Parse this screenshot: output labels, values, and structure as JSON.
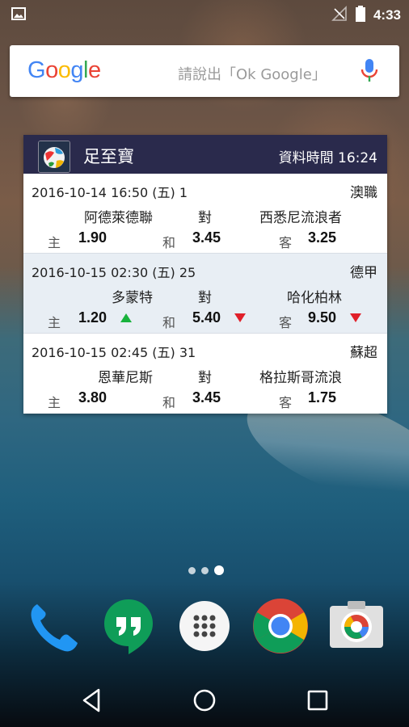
{
  "status_bar": {
    "time": "4:33",
    "icons": [
      "image-notification-icon",
      "no-signal-icon",
      "battery-icon"
    ]
  },
  "search_bar": {
    "logo": "Google",
    "hint": "請說出「Ok Google」",
    "mic_icon": "mic-icon"
  },
  "widget": {
    "app_name": "足至寶",
    "update_time": "資料時間 16:24",
    "matches": [
      {
        "datetime": "2016-10-14 16:50 (五) 1",
        "league": "澳職",
        "home_team": "阿德萊德聯",
        "vs": "對",
        "away_team": "西悉尼流浪者",
        "home_label": "主",
        "home_odds": "1.90",
        "draw_label": "和",
        "draw_odds": "3.45",
        "away_label": "客",
        "away_odds": "3.25"
      },
      {
        "datetime": "2016-10-15 02:30 (五) 25",
        "league": "德甲",
        "home_team": "多蒙特",
        "vs": "對",
        "away_team": "哈化柏林",
        "home_label": "主",
        "home_odds": "1.20",
        "home_trend": "up",
        "draw_label": "和",
        "draw_odds": "5.40",
        "draw_trend": "down",
        "away_label": "客",
        "away_odds": "9.50",
        "away_trend": "down"
      },
      {
        "datetime": "2016-10-15 02:45 (五) 31",
        "league": "蘇超",
        "home_team": "恩華尼斯",
        "vs": "對",
        "away_team": "格拉斯哥流浪",
        "home_label": "主",
        "home_odds": "3.80",
        "draw_label": "和",
        "draw_odds": "3.45",
        "away_label": "客",
        "away_odds": "1.75"
      }
    ]
  },
  "colors": {
    "widget_header": "#2a2a4c",
    "row_alt": "#e8eef4",
    "trend_up": "#18b23c",
    "trend_down": "#e0202a"
  },
  "dock": [
    "phone-icon",
    "hangouts-icon",
    "app-drawer-icon",
    "chrome-icon",
    "camera-icon"
  ],
  "nav": [
    "back-icon",
    "home-icon",
    "recents-icon"
  ]
}
